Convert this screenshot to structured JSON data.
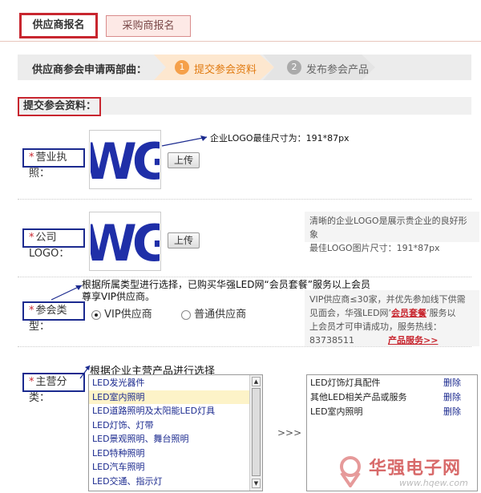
{
  "tabs": [
    {
      "label": "供应商报名",
      "active": true
    },
    {
      "label": "采购商报名",
      "active": false
    }
  ],
  "steps": {
    "title": "供应商参会申请两部曲：",
    "items": [
      {
        "num": "1",
        "label": "提交参会资料",
        "active": true
      },
      {
        "num": "2",
        "label": "发布参会产品",
        "active": false
      }
    ]
  },
  "section": {
    "title": "提交参会资料："
  },
  "business_license": {
    "label": "营业执照：",
    "upload_label": "上传",
    "logo_text": "WG",
    "annotation": "企业LOGO最佳尺寸为：191*87px"
  },
  "company_logo": {
    "label": "公司LOGO：",
    "upload_label": "上传",
    "logo_text": "WG",
    "hint_line1": "清晰的企业LOGO是展示贵企业的良好形象",
    "hint_line2": "最佳LOGO图片尺寸：191*87px"
  },
  "participant_type": {
    "label": "参会类型：",
    "annotation_line1": "根据所属类型进行选择，已购买华强LED网“会员套餐”服务以上会员",
    "annotation_line2": "尊享VIP供应商。",
    "options": [
      {
        "label": "VIP供应商",
        "selected": true
      },
      {
        "label": "普通供应商",
        "selected": false
      }
    ],
    "hint_line1": "VIP供应商≤30家，并优先参加线下供需",
    "hint_line2": "见面会，华强LED网’",
    "hint_link1": "会员套餐",
    "hint_line2b": "’服务以",
    "hint_line3": "上会员才可申请成功，服务热线：",
    "hint_phone": "83738511",
    "hint_link2": "产品服务>>"
  },
  "main_category": {
    "label": "主营分类：",
    "annotation": "根据企业主营产品进行选择",
    "available": [
      "LED发光器件",
      "LED室内照明",
      "LED道路照明及太阳能LED灯具",
      "LED灯饰、灯带",
      "LED景观照明、舞台照明",
      "LED特种照明",
      "LED汽车照明",
      "LED交通、指示灯"
    ],
    "selected_available_index": 1,
    "move_label": ">>>",
    "selected": [
      {
        "label": "LED灯饰灯具配件",
        "action": "删除"
      },
      {
        "label": "其他LED相关产品或服务",
        "action": "删除"
      },
      {
        "label": "LED室内照明",
        "action": "删除"
      }
    ]
  },
  "watermark": {
    "text": "华强电子网",
    "url": "www.hqew.com"
  },
  "colors": {
    "accent_red": "#c8262f",
    "annotation_blue": "#1b2a8f",
    "step_active": "#f5a04a"
  }
}
